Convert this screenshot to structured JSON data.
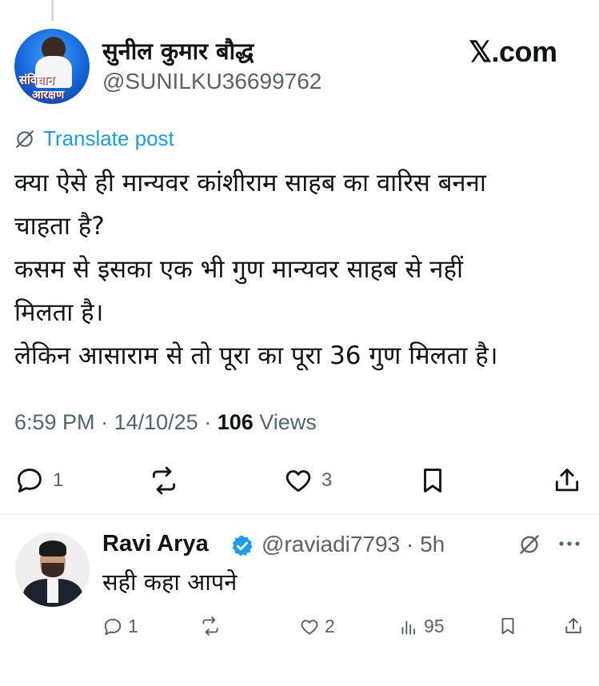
{
  "author": {
    "name": "सुनील कुमार बौद्ध",
    "handle": "@SUNILKU36699762",
    "avatar_text_top": "संविधान",
    "avatar_text_bottom": "आरक्षण"
  },
  "brand": "𝕏.com",
  "translate_label": "Translate post",
  "post": {
    "lines": [
      "क्या ऐसे ही मान्यवर कांशीराम साहब का वारिस बनना",
      "चाहता है?",
      "कसम से इसका एक भी गुण मान्यवर साहब से नहीं",
      "मिलता है।",
      "लेकिन आसाराम से तो पूरा का पूरा 36 गुण मिलता है।"
    ],
    "time": "6:59 PM",
    "date": "14/10/25",
    "views_count": "106",
    "views_label": "Views",
    "replies": "1",
    "reposts": "",
    "likes": "3"
  },
  "reply": {
    "name": "Ravi Arya",
    "handle_time": "@raviadi7793 · 5h",
    "text": "सही कहा आपने",
    "replies": "1",
    "reposts": "",
    "likes": "2",
    "views": "95"
  },
  "icons": {
    "translate": "globe-slash-icon",
    "reply": "speech-bubble-icon",
    "repost": "repost-arrows-icon",
    "like": "heart-icon",
    "bookmark": "bookmark-icon",
    "share": "share-upload-icon",
    "verified": "verified-badge-icon",
    "views": "bar-chart-icon",
    "more": "more-dots-icon"
  },
  "colors": {
    "text": "#0f1419",
    "secondary": "#536471",
    "link": "#1d9bf0",
    "verified": "#1d9bf0",
    "divider": "#eff3f4"
  }
}
